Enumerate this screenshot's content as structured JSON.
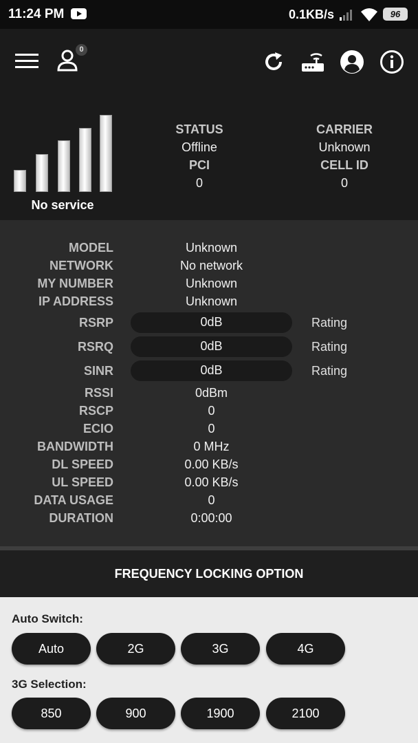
{
  "status_bar": {
    "time": "11:24 PM",
    "speed": "0.1KB/s",
    "battery": "96"
  },
  "appbar": {
    "icons": [
      "menu-icon",
      "user-icon",
      "refresh-icon",
      "router-icon",
      "account-icon",
      "info-icon"
    ],
    "user_badge": "0"
  },
  "hero": {
    "signal_text": "No service",
    "status_label": "STATUS",
    "status_value": "Offline",
    "carrier_label": "CARRIER",
    "carrier_value": "Unknown",
    "pci_label": "PCI",
    "pci_value": "0",
    "cellid_label": "CELL ID",
    "cellid_value": "0"
  },
  "details": {
    "model": {
      "label": "MODEL",
      "value": "Unknown"
    },
    "network": {
      "label": "NETWORK",
      "value": "No network"
    },
    "my_number": {
      "label": "MY NUMBER",
      "value": "Unknown"
    },
    "ip_address": {
      "label": "IP ADDRESS",
      "value": "Unknown"
    },
    "rsrp": {
      "label": "RSRP",
      "value": "0dB",
      "rating": "Rating"
    },
    "rsrq": {
      "label": "RSRQ",
      "value": "0dB",
      "rating": "Rating"
    },
    "sinr": {
      "label": "SINR",
      "value": "0dB",
      "rating": "Rating"
    },
    "rssi": {
      "label": "RSSI",
      "value": "0dBm"
    },
    "rscp": {
      "label": "RSCP",
      "value": "0"
    },
    "ecio": {
      "label": "ECIO",
      "value": "0"
    },
    "bandwidth": {
      "label": "BANDWIDTH",
      "value": "0 MHz"
    },
    "dl_speed": {
      "label": "DL SPEED",
      "value": "0.00 KB/s"
    },
    "ul_speed": {
      "label": "UL SPEED",
      "value": "0.00 KB/s"
    },
    "data_usage": {
      "label": "DATA USAGE",
      "value": "0"
    },
    "duration": {
      "label": "DURATION",
      "value": "0:00:00"
    }
  },
  "frequency": {
    "title": "FREQUENCY LOCKING OPTION",
    "auto_switch_label": "Auto Switch:",
    "auto_switch_buttons": [
      "Auto",
      "2G",
      "3G",
      "4G"
    ],
    "g3_label": "3G Selection:",
    "g3_buttons": [
      "850",
      "900",
      "1900",
      "2100"
    ]
  }
}
